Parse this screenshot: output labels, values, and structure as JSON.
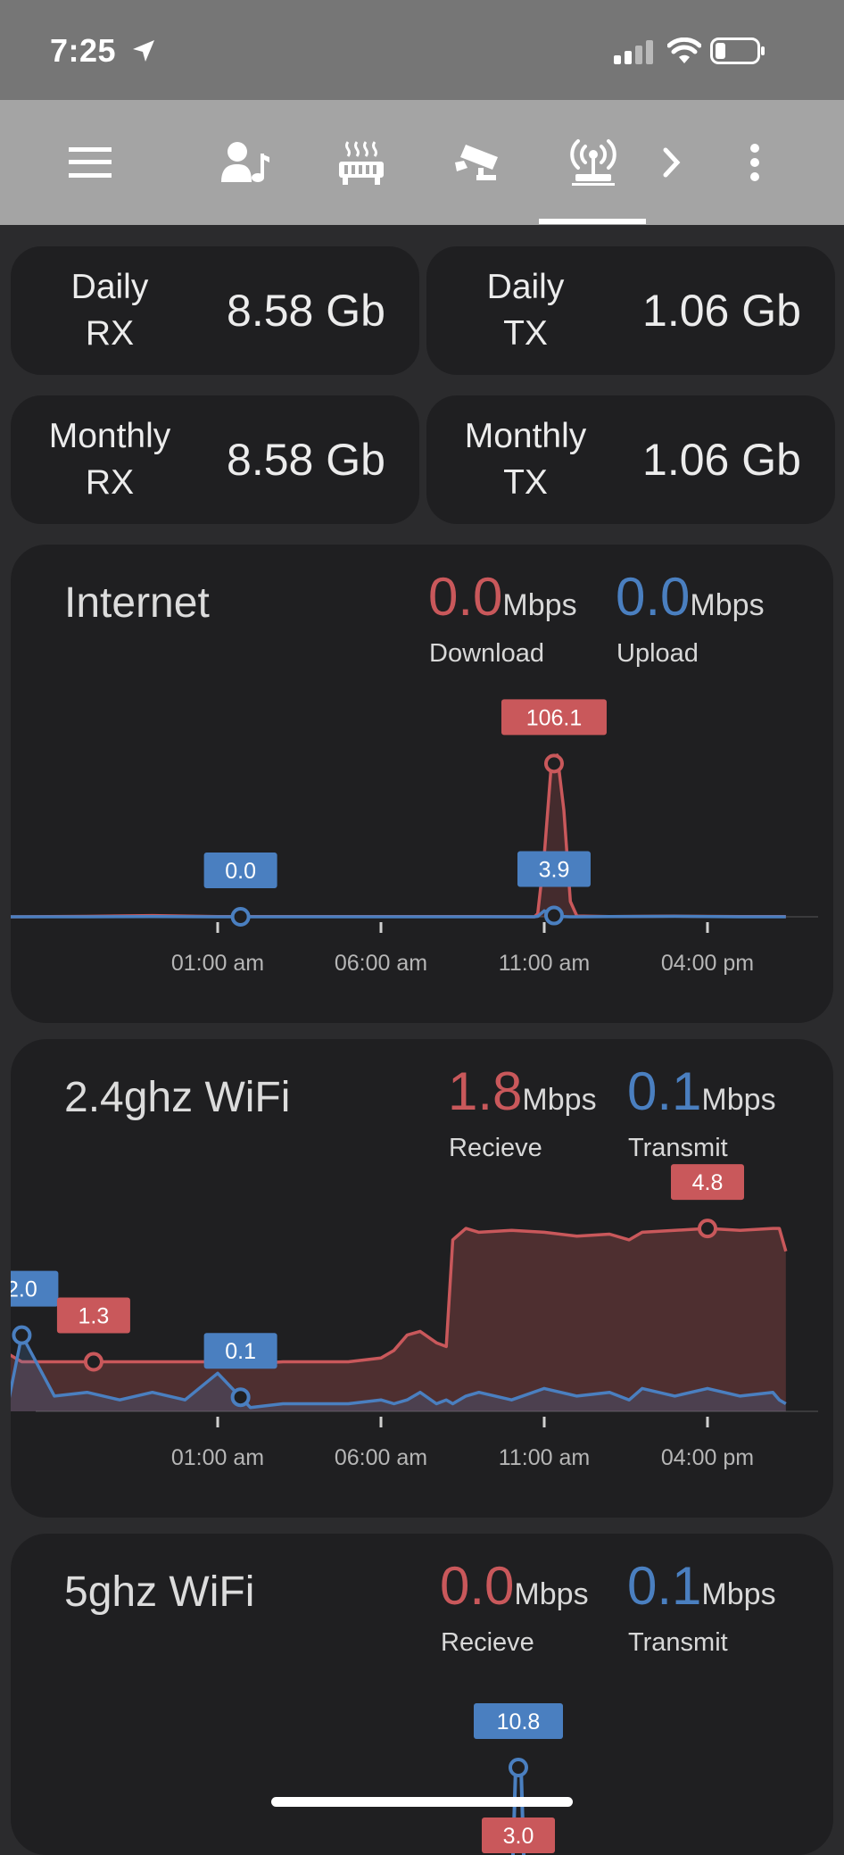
{
  "status": {
    "time": "7:25"
  },
  "nav": {
    "items": [
      {
        "name": "menu-icon"
      },
      {
        "name": "person-music-icon"
      },
      {
        "name": "router-icon"
      },
      {
        "name": "security-camera-icon"
      },
      {
        "name": "wifi-antenna-icon",
        "active": true
      },
      {
        "name": "chevron-right-icon"
      },
      {
        "name": "more-vertical-icon"
      }
    ]
  },
  "stats": [
    {
      "label_line1": "Daily",
      "label_line2": "RX",
      "value": "8.58 Gb"
    },
    {
      "label_line1": "Daily",
      "label_line2": "TX",
      "value": "1.06 Gb"
    },
    {
      "label_line1": "Monthly",
      "label_line2": "RX",
      "value": "8.58 Gb"
    },
    {
      "label_line1": "Monthly",
      "label_line2": "TX",
      "value": "1.06 Gb"
    }
  ],
  "colors": {
    "receive": "#c9585b",
    "transmit": "#4a7fc0",
    "card": "#1f1f21",
    "background": "#2b2b2d"
  },
  "cards": {
    "internet": {
      "title": "Internet",
      "rx_value": "0.0",
      "rx_unit": "Mbps",
      "rx_label": "Download",
      "tx_value": "0.0",
      "tx_unit": "Mbps",
      "tx_label": "Upload"
    },
    "wifi24": {
      "title": "2.4ghz WiFi",
      "rx_value": "1.8",
      "rx_unit": "Mbps",
      "rx_label": "Recieve",
      "tx_value": "0.1",
      "tx_unit": "Mbps",
      "tx_label": "Transmit"
    },
    "wifi5": {
      "title": "5ghz WiFi",
      "rx_value": "0.0",
      "rx_unit": "Mbps",
      "rx_label": "Recieve",
      "tx_value": "0.1",
      "tx_unit": "Mbps",
      "tx_label": "Transmit"
    }
  },
  "chart_data": [
    {
      "type": "line",
      "title": "Internet",
      "x_ticks": [
        "01:00 am",
        "06:00 am",
        "11:00 am",
        "04:00 pm"
      ],
      "x_hours": [
        -6.6,
        -4,
        -2,
        0,
        1,
        3,
        5,
        6,
        8,
        9.7,
        9.8,
        10,
        10.2,
        10.4,
        10.6,
        10.8,
        11,
        12,
        14,
        16,
        17.4
      ],
      "series": [
        {
          "name": "Download",
          "values": [
            0,
            0.3,
            0.8,
            0.2,
            0.1,
            0.2,
            0.1,
            0.2,
            0.1,
            0,
            2,
            40,
            95,
            106.1,
            70,
            10,
            0.5,
            0.2,
            0.4,
            0.2,
            0.1
          ]
        },
        {
          "name": "Upload",
          "values": [
            0,
            0,
            0.1,
            0,
            0,
            0,
            0,
            0,
            0,
            0,
            0.3,
            3.9,
            1.5,
            0.2,
            0.1,
            0,
            0,
            0.1,
            0.3,
            0,
            0
          ]
        }
      ],
      "markers": [
        {
          "series": "Download",
          "x": 10.3,
          "label": "106.1"
        },
        {
          "series": "Upload",
          "x": 0.7,
          "label": "0.0"
        },
        {
          "series": "Upload",
          "x": 10.3,
          "label": "3.9"
        }
      ],
      "ylim": [
        0,
        140
      ]
    },
    {
      "type": "area",
      "title": "2.4ghz WiFi",
      "x_ticks": [
        "01:00 am",
        "06:00 am",
        "11:00 am",
        "04:00 pm"
      ],
      "x_hours": [
        -6.6,
        -6.4,
        -6,
        -5,
        -4,
        -3,
        -2,
        -1,
        0,
        1,
        2,
        4,
        5,
        5.4,
        5.8,
        6.2,
        6.7,
        7,
        7.2,
        7.6,
        8,
        9,
        10,
        11,
        12,
        12.6,
        13,
        14,
        15,
        16,
        17,
        17.2,
        17.4
      ],
      "series": [
        {
          "name": "Recieve",
          "values": [
            1.6,
            1.5,
            1.3,
            1.3,
            1.3,
            1.3,
            1.3,
            1.3,
            1.3,
            1.25,
            1.3,
            1.3,
            1.4,
            1.6,
            2.0,
            2.1,
            1.8,
            1.7,
            4.5,
            4.8,
            4.7,
            4.75,
            4.7,
            4.6,
            4.65,
            4.5,
            4.7,
            4.75,
            4.8,
            4.75,
            4.8,
            4.8,
            4.2
          ]
        },
        {
          "name": "Transmit",
          "values": [
            0.2,
            0.3,
            2.0,
            0.4,
            0.5,
            0.3,
            0.5,
            0.3,
            1.0,
            0.1,
            0.2,
            0.2,
            0.3,
            0.2,
            0.3,
            0.5,
            0.2,
            0.3,
            0.2,
            0.4,
            0.5,
            0.3,
            0.6,
            0.4,
            0.5,
            0.3,
            0.6,
            0.4,
            0.6,
            0.4,
            0.5,
            0.3,
            0.2
          ]
        }
      ],
      "markers": [
        {
          "series": "Transmit",
          "x": -6,
          "label": "2.0"
        },
        {
          "series": "Recieve",
          "x": -3.8,
          "label": "1.3"
        },
        {
          "series": "Transmit",
          "x": 0.7,
          "label": "0.1"
        },
        {
          "series": "Recieve",
          "x": 15,
          "label": "4.8"
        }
      ],
      "ylim": [
        0,
        5.6
      ]
    },
    {
      "type": "line",
      "title": "5ghz WiFi",
      "markers": [
        {
          "series": "Transmit",
          "label": "10.8"
        },
        {
          "series": "Recieve",
          "label": "3.0"
        }
      ]
    }
  ]
}
